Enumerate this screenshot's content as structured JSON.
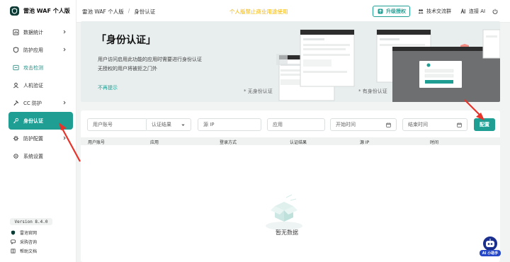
{
  "app": {
    "title": "雷池 WAF 个人版"
  },
  "sidebar": {
    "items": [
      {
        "label": "数据统计",
        "icon": "chart-icon",
        "has_children": true
      },
      {
        "label": "防护应用",
        "icon": "shield-icon",
        "has_children": true
      },
      {
        "label": "攻击检测",
        "icon": "detect-icon",
        "has_children": false
      },
      {
        "label": "人机验证",
        "icon": "user-verify-icon",
        "has_children": false
      },
      {
        "label": "CC 防护",
        "icon": "hammer-icon",
        "has_children": true
      },
      {
        "label": "身份认证",
        "icon": "key-icon",
        "has_children": false
      },
      {
        "label": "防护配置",
        "icon": "gear-shield-icon",
        "has_children": true
      },
      {
        "label": "系统设置",
        "icon": "gear-icon",
        "has_children": false
      }
    ],
    "version": "Version 8.4.0",
    "links": [
      {
        "label": "雷池官网",
        "icon": "home-shield-icon"
      },
      {
        "label": "采购咨询",
        "icon": "chat-icon"
      },
      {
        "label": "帮助文档",
        "icon": "book-icon"
      }
    ]
  },
  "header": {
    "breadcrumb": [
      "雷池 WAF 个人版",
      "身份认证"
    ],
    "separator": "/",
    "notice": "个人版禁止商业用途使用",
    "upgrade": "升级授权",
    "tech_group": "技术交流群",
    "connect_ai": "连接 AI"
  },
  "banner": {
    "title": "「身份认证」",
    "desc1": "用户访问启用此功能的应用时需要进行身份认证",
    "desc2": "无授权的用户将被拒之门外",
    "link": "不再提示",
    "caption_left": "* 无身份认证",
    "caption_right": "* 有身份认证"
  },
  "filters": {
    "user_account": "用户账号",
    "auth_result": "认证结果",
    "source_ip": "源 IP",
    "app": "应用",
    "start_time": "开始时间",
    "end_time": "结束时间",
    "config_button": "配置"
  },
  "table": {
    "columns": [
      "用户账号",
      "应用",
      "登录方式",
      "认证结果",
      "源 IP",
      "时间"
    ],
    "rows": [],
    "empty_text": "暂无数据"
  },
  "ai_helper": {
    "label": "AI 小助手"
  },
  "colors": {
    "accent": "#1f9e93",
    "notice": "#f4b400",
    "annotation": "#e8332a"
  }
}
